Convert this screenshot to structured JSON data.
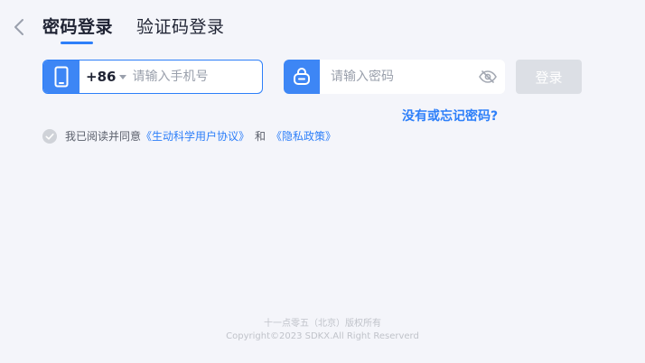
{
  "header": {
    "tabs": [
      {
        "label": "密码登录",
        "active": true
      },
      {
        "label": "验证码登录",
        "active": false
      }
    ]
  },
  "form": {
    "phone": {
      "country_code": "+86",
      "placeholder": "请输入手机号",
      "value": ""
    },
    "password": {
      "placeholder": "请输入密码",
      "value": ""
    },
    "login_label": "登录",
    "forgot_label": "没有或忘记密码?"
  },
  "agreement": {
    "prefix": "我已阅读并同意",
    "terms_link": "《生动科学用户协议》",
    "and": "和",
    "privacy_link": "《隐私政策》",
    "checked": false
  },
  "footer": {
    "company": "十一点零五（北京）版权所有",
    "copyright": "Copyright©2023 SDKX.All Right Reserverd"
  },
  "colors": {
    "accent": "#2d7ff9",
    "icon_block": "#3d86f5",
    "disabled_button": "#dcdfe5",
    "background": "#f4f5fa"
  },
  "icons": {
    "back": "chevron-left-icon",
    "phone": "mobile-phone-icon",
    "lock": "lock-icon",
    "eye": "eye-hidden-icon",
    "check": "check-circle-icon"
  }
}
